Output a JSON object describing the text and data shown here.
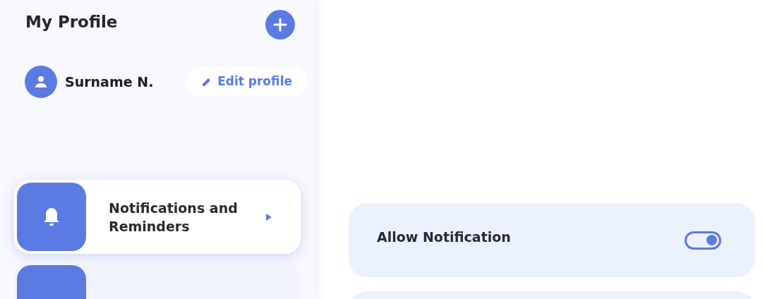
{
  "sidebar": {
    "title": "My Profile",
    "user": {
      "name": "Surname N.",
      "edit_label": "Edit profile"
    },
    "menu_items": [
      {
        "kind": "labeled",
        "label": "Notifications and Reminders",
        "selected": true
      },
      {
        "kind": "cut",
        "selected": false
      }
    ]
  },
  "settings": [
    {
      "kind": "toggle",
      "label": "Allow Notification",
      "on": true
    },
    {
      "kind": "cut"
    }
  ]
}
